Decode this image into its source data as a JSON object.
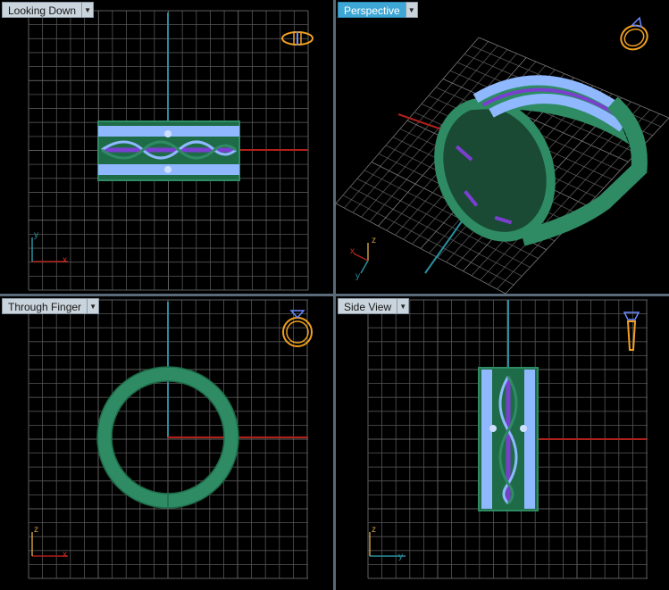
{
  "viewports": {
    "top_left": {
      "title": "Looking Down"
    },
    "top_right": {
      "title": "Perspective"
    },
    "bottom_left": {
      "title": "Through Finger"
    },
    "bottom_right": {
      "title": "Side View"
    }
  },
  "axes": {
    "looking_down": {
      "vertical": "y",
      "horizontal": "x"
    },
    "perspective": {
      "a": "x",
      "b": "z",
      "c": "y"
    },
    "through_finger": {
      "vertical": "z",
      "horizontal": "x"
    },
    "side_view": {
      "vertical": "z",
      "horizontal": "y"
    }
  },
  "colors": {
    "grid": "#555555",
    "grid_major": "#7a7a7a",
    "ring_green": "#2e8b63",
    "ring_green_dark": "#1e6b48",
    "ring_light": "#8fb8ff",
    "ring_purple": "#7a3fd0",
    "axis_red": "#b0201a",
    "axis_teal": "#2a8fa0",
    "icon_orange": "#f0a020",
    "active_tab": "#3fa7d6"
  }
}
